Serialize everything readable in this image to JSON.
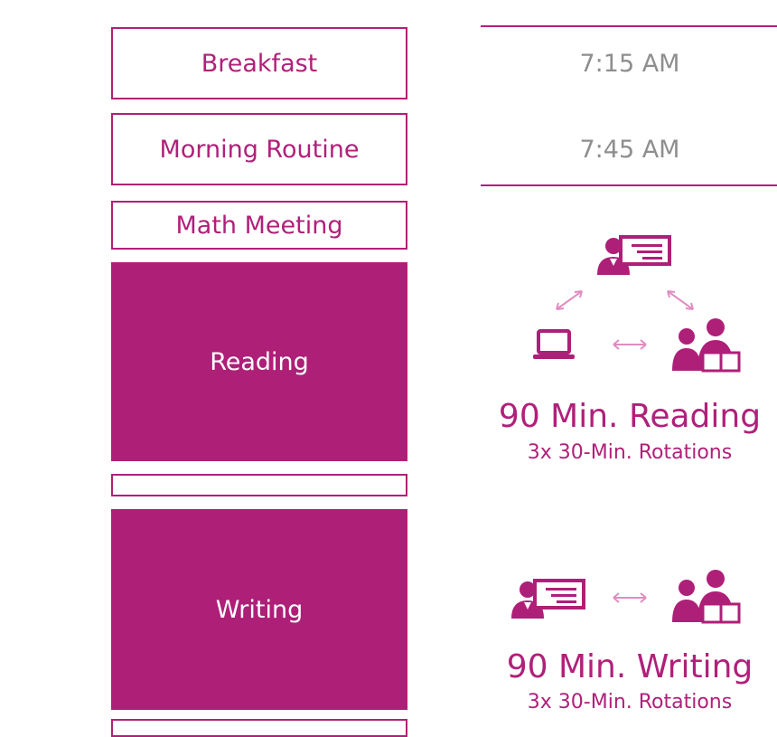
{
  "schedule": {
    "breakfast": {
      "label": "Breakfast",
      "time": "7:15 AM"
    },
    "morning_routine": {
      "label": "Morning Routine",
      "time": "7:45 AM"
    },
    "math_meeting": {
      "label": "Math Meeting"
    },
    "reading": {
      "label": "Reading"
    },
    "writing": {
      "label": "Writing"
    }
  },
  "reading_model": {
    "title": "90 Min. Reading",
    "subtitle": "3x 30-Min. Rotations",
    "icons": [
      "teacher-led-icon",
      "laptop-icon",
      "small-group-icon"
    ]
  },
  "writing_model": {
    "title": "90 Min. Writing",
    "subtitle": "3x 30-Min. Rotations",
    "icons": [
      "teacher-led-icon",
      "small-group-icon"
    ]
  },
  "colors": {
    "accent": "#ae1f78",
    "muted_text": "#8e8e8e",
    "arrow": "#e08cc0"
  }
}
